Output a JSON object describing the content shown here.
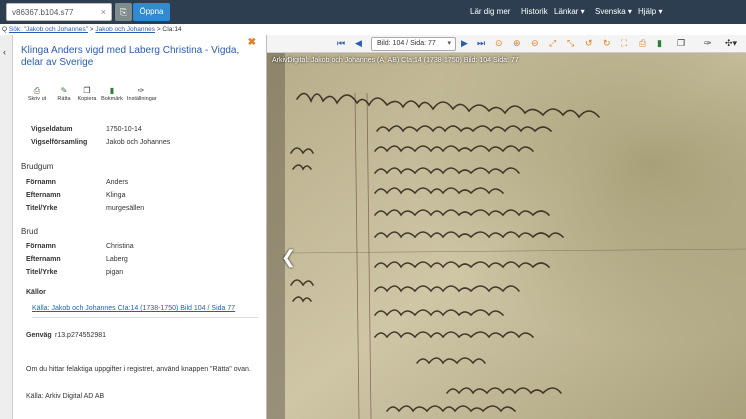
{
  "topbar": {
    "address_value": "v86367.b104.s77",
    "open_label": "Öppna",
    "nav": {
      "learn": "Lär dig mer",
      "history": "Historik",
      "links": "Länkar ▾",
      "language": "Svenska ▾",
      "help": "Hjälp ▾"
    }
  },
  "breadcrumb": {
    "prefix": "Q",
    "search_link": "Sök: \"Jakob och Johannes\"",
    "sep1": ">",
    "parish_link": "Jakob och Johannes",
    "sep2": ">",
    "volume": "CIa:14"
  },
  "panel": {
    "title": "Klinga Anders vigd med Laberg Christina - Vigda, delar av Sverige",
    "tools": {
      "print": "Skriv ut",
      "correct": "Rätta",
      "copy": "Kopiera",
      "bookmark": "Bokmärk",
      "settings": "Inställningar"
    },
    "vigsel": {
      "date_label": "Vigseldatum",
      "date_value": "1750-10-14",
      "parish_label": "Vigselförsamling",
      "parish_value": "Jakob och Johannes"
    },
    "brudgum": {
      "heading": "Brudgum",
      "first_label": "Förnamn",
      "first_value": "Anders",
      "last_label": "Efternamn",
      "last_value": "Klinga",
      "title_label": "Titel/Yrke",
      "title_value": "murgesällen"
    },
    "brud": {
      "heading": "Brud",
      "first_label": "Förnamn",
      "first_value": "Christina",
      "last_label": "Efternamn",
      "last_value": "Laberg",
      "title_label": "Titel/Yrke",
      "title_value": "pigan"
    },
    "sources_heading": "Källor",
    "source_link": "Källa: Jakob och Johannes CIa:14 (1738-1750) Bild 104 / Sida 77",
    "genvag_label": "Genväg",
    "genvag_value": "r13.p274552981",
    "note": "Om du hittar felaktiga uppgifter i registret, använd knappen \"Rätta\" ovan.",
    "source_ad": "Källa: Arkiv Digital AD AB"
  },
  "viewer": {
    "page_select": "Bild: 104 / Sida: 77",
    "caption": "ArkivDigital: Jakob och Johannes (A, AB) CIa:14 (1738-1750) Bild: 104 Sida: 77"
  },
  "colors": {
    "topbar": "#2c3e50",
    "accent_blue": "#2f8ad0",
    "link": "#2a5db0",
    "orange": "#e67e22",
    "green": "#2e7d32"
  }
}
